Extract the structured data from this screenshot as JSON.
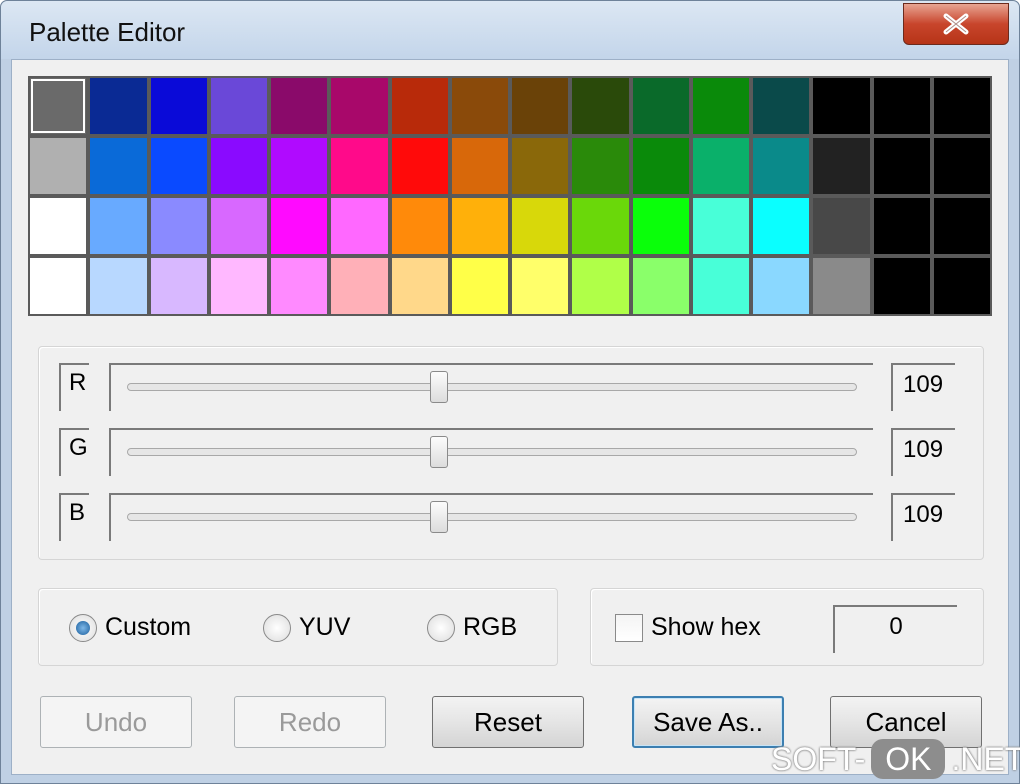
{
  "window": {
    "title": "Palette Editor",
    "close_icon": "close-x-icon"
  },
  "palette": {
    "rows": [
      [
        "#6a6a6a",
        "#0a2a94",
        "#0a0ad8",
        "#6a48d8",
        "#8a0a6a",
        "#a8086a",
        "#b82a0a",
        "#8a4a0a",
        "#6a4208",
        "#2a4a0a",
        "#0a6a2a",
        "#0a8a0a",
        "#0a4a4a",
        "#000000",
        "#000000",
        "#000000"
      ],
      [
        "#b0b0b0",
        "#0a6ad8",
        "#0a4aff",
        "#8a0aff",
        "#b00aff",
        "#ff0a8a",
        "#ff0a0a",
        "#d8680a",
        "#8a680a",
        "#2a8a0a",
        "#0a8a0a",
        "#0ab06a",
        "#0a8a8a",
        "#222222",
        "#000000",
        "#000000"
      ],
      [
        "#ffffff",
        "#68aaff",
        "#8a8aff",
        "#d868ff",
        "#ff0aff",
        "#ff68ff",
        "#ff8a0a",
        "#ffb00a",
        "#d8d80a",
        "#6ad80a",
        "#0aff0a",
        "#48ffd8",
        "#0affff",
        "#484848",
        "#000000",
        "#000000"
      ],
      [
        "#ffffff",
        "#b8d8ff",
        "#d8b8ff",
        "#ffb8ff",
        "#ff8aff",
        "#ffb0b8",
        "#ffd88a",
        "#ffff48",
        "#ffff6a",
        "#b0ff48",
        "#8aff6a",
        "#48ffd8",
        "#8ad8ff",
        "#8a8a8a",
        "#000000",
        "#000000"
      ]
    ],
    "selected": [
      0,
      0
    ]
  },
  "sliders": {
    "items": [
      {
        "label": "R",
        "value": "109",
        "level": 0.427
      },
      {
        "label": "G",
        "value": "109",
        "level": 0.427
      },
      {
        "label": "B",
        "value": "109",
        "level": 0.427
      }
    ]
  },
  "mode": {
    "options": [
      {
        "label": "Custom",
        "checked": true
      },
      {
        "label": "YUV",
        "checked": false
      },
      {
        "label": "RGB",
        "checked": false
      }
    ]
  },
  "hex": {
    "label": "Show hex",
    "checked": false,
    "value": "0"
  },
  "buttons": {
    "undo": "Undo",
    "redo": "Redo",
    "reset": "Reset",
    "save_as": "Save As..",
    "cancel": "Cancel"
  },
  "watermark": {
    "prefix": "SOFT-",
    "badge": "OK",
    "suffix": ".NET"
  },
  "colors": {
    "title_bar": "#c3d5ea",
    "close_button": "#c8452c",
    "dialog_face": "#f0f0f0",
    "default_button_border": "#3c7fb1"
  }
}
